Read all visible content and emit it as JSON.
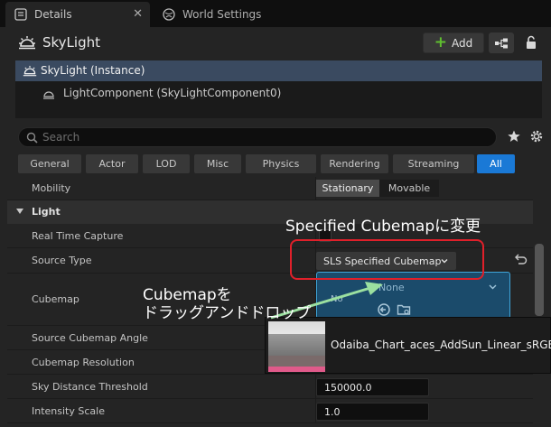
{
  "tabs": [
    {
      "label": "Details",
      "active": true
    },
    {
      "label": "World Settings",
      "active": false
    }
  ],
  "tab_close": "✕",
  "actor": {
    "title": "SkyLight"
  },
  "toolbar": {
    "add_label": "Add"
  },
  "tree": {
    "selected": "SkyLight (Instance)",
    "child": "LightComponent (SkyLightComponent0)"
  },
  "search": {
    "placeholder": "Search"
  },
  "filters": [
    "General",
    "Actor",
    "LOD",
    "Misc",
    "Physics",
    "Rendering",
    "Streaming",
    "All"
  ],
  "active_filter": "All",
  "properties": {
    "mobility": {
      "label": "Mobility",
      "options": [
        "Stationary",
        "Movable"
      ],
      "selected": "Stationary"
    },
    "light_section": "Light",
    "real_time_capture": {
      "label": "Real Time Capture",
      "checked": false
    },
    "source_type": {
      "label": "Source Type",
      "value": "SLS Specified Cubemap"
    },
    "cubemap": {
      "label": "Cubemap",
      "value": "None",
      "thumb_label": "No"
    },
    "source_cubemap_angle": {
      "label": "Source Cubemap Angle"
    },
    "cubemap_resolution": {
      "label": "Cubemap Resolution"
    },
    "sky_distance_threshold": {
      "label": "Sky Distance Threshold",
      "value": "150000.0"
    },
    "intensity_scale": {
      "label": "Intensity Scale",
      "value": "1.0"
    }
  },
  "drag_asset": {
    "name": "Odaiba_Chart_aces_AddSun_Linear_sRGB"
  },
  "annotations": {
    "specified_cubemap": "Specified Cubemapに変更",
    "drag_drop_line1": "Cubemapを",
    "drag_drop_line2": "ドラッグアンドドロップ"
  },
  "colors": {
    "accent": "#1a79d6",
    "highlight_box": "#e0202a",
    "drop_target": "#1b4b6b",
    "arrow": "#9be0a0"
  }
}
